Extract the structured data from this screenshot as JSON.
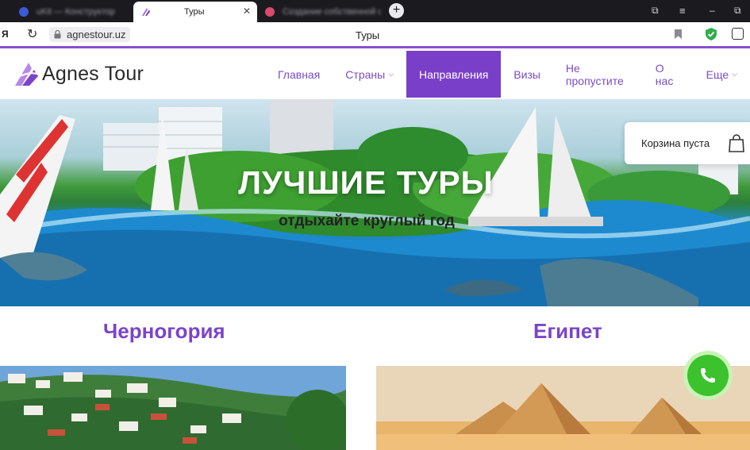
{
  "browser": {
    "tabs": [
      {
        "title": "uKit — Конструктор",
        "active": false
      },
      {
        "title": "Туры",
        "active": true
      },
      {
        "title": "Создание собственной ст...",
        "active": false
      }
    ],
    "address": "agnestour.uz",
    "page_title": "Туры",
    "yandex_glyph": "Я",
    "accent_color": "#8a4fd0"
  },
  "site": {
    "logo_text": "Agnes Tour",
    "nav": [
      {
        "label": "Главная",
        "active": false,
        "dropdown": false
      },
      {
        "label": "Страны",
        "active": false,
        "dropdown": true
      },
      {
        "label": "Направления",
        "active": true,
        "dropdown": false
      },
      {
        "label": "Визы",
        "active": false,
        "dropdown": false
      },
      {
        "label": "Не пропустите",
        "active": false,
        "dropdown": false
      },
      {
        "label": "О нас",
        "active": false,
        "dropdown": false
      },
      {
        "label": "Еще",
        "active": false,
        "dropdown": true
      }
    ],
    "nav_color": "#7b4cc6",
    "nav_active_color": "#7a3fc9"
  },
  "hero": {
    "title": "ЛУЧШИЕ ТУРЫ",
    "subtitle": "отдыхайте круглый год"
  },
  "cart": {
    "label": "Корзина пуста",
    "icon": "shopping-bag-icon"
  },
  "destinations": [
    {
      "name": "Черногория"
    },
    {
      "name": "Египет"
    }
  ],
  "call_button": {
    "icon": "phone-icon",
    "color": "#3bc22d"
  }
}
